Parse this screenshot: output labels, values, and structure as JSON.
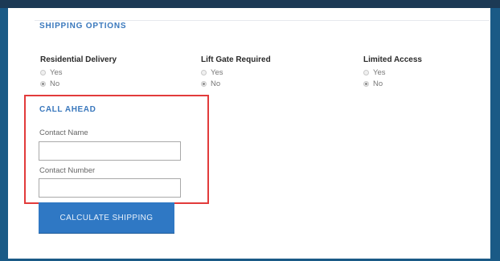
{
  "shipping": {
    "title": "SHIPPING OPTIONS",
    "groups": [
      {
        "label": "Residential Delivery",
        "options": [
          "Yes",
          "No"
        ],
        "selected": "No"
      },
      {
        "label": "Lift Gate Required",
        "options": [
          "Yes",
          "No"
        ],
        "selected": "No"
      },
      {
        "label": "Limited Access",
        "options": [
          "Yes",
          "No"
        ],
        "selected": "No"
      }
    ]
  },
  "call_ahead": {
    "title": "CALL AHEAD",
    "contact_name_label": "Contact Name",
    "contact_name_value": "",
    "contact_number_label": "Contact Number",
    "contact_number_value": ""
  },
  "actions": {
    "calculate_label": "CALCULATE SHIPPING"
  },
  "colors": {
    "accent": "#2f78c4",
    "highlight_border": "#e23b3b",
    "frame": "#1a5a86"
  }
}
